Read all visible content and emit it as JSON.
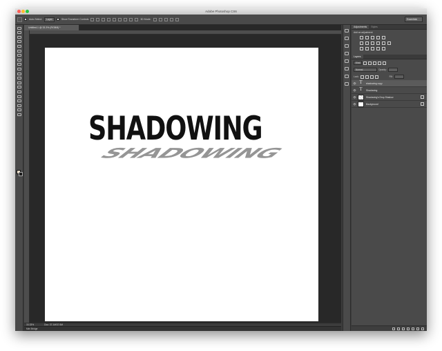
{
  "app": {
    "window_title": "Adobe Photoshop CS6",
    "workspace": "Essentials",
    "document_tab": "Untitled-1 @ 33.3% (RGB/8) *",
    "zoom": "33.33%",
    "doc_size": "Doc: 37.1M/37.6M",
    "mini_bridge": "Mini Bridge"
  },
  "options_bar": {
    "auto_select_label": "Auto-Select:",
    "auto_select_value": "Layer",
    "show_transform_label": "Show Transform Controls",
    "mode_3d_label": "3D Mode:"
  },
  "canvas": {
    "text": "SHADOWING",
    "shadow_text": "SHADOWING"
  },
  "panels": {
    "top_tabs": [
      {
        "label": "Adjustments",
        "active": true
      },
      {
        "label": "Styles",
        "active": false
      }
    ],
    "add_adjustment_label": "Add an adjustment",
    "layers_tab": "Layers",
    "kind_label": "Kind",
    "blend_mode": "Normal",
    "opacity_label": "Opacity:",
    "lock_label": "Lock:",
    "fill_label": "Fill:",
    "layers": [
      {
        "name": "shadowing copy",
        "kind": "type",
        "selected": true
      },
      {
        "name": "Shadowing",
        "kind": "type",
        "selected": false
      },
      {
        "name": "Shadowing's Drop Shadow",
        "kind": "raster",
        "selected": false
      },
      {
        "name": "Background",
        "kind": "background",
        "selected": false
      }
    ]
  },
  "colors": {
    "foreground": "#e9dcc8",
    "background": "#1a1a1a",
    "ui_dark": "#3c3c3c",
    "canvas": "#ffffff"
  }
}
